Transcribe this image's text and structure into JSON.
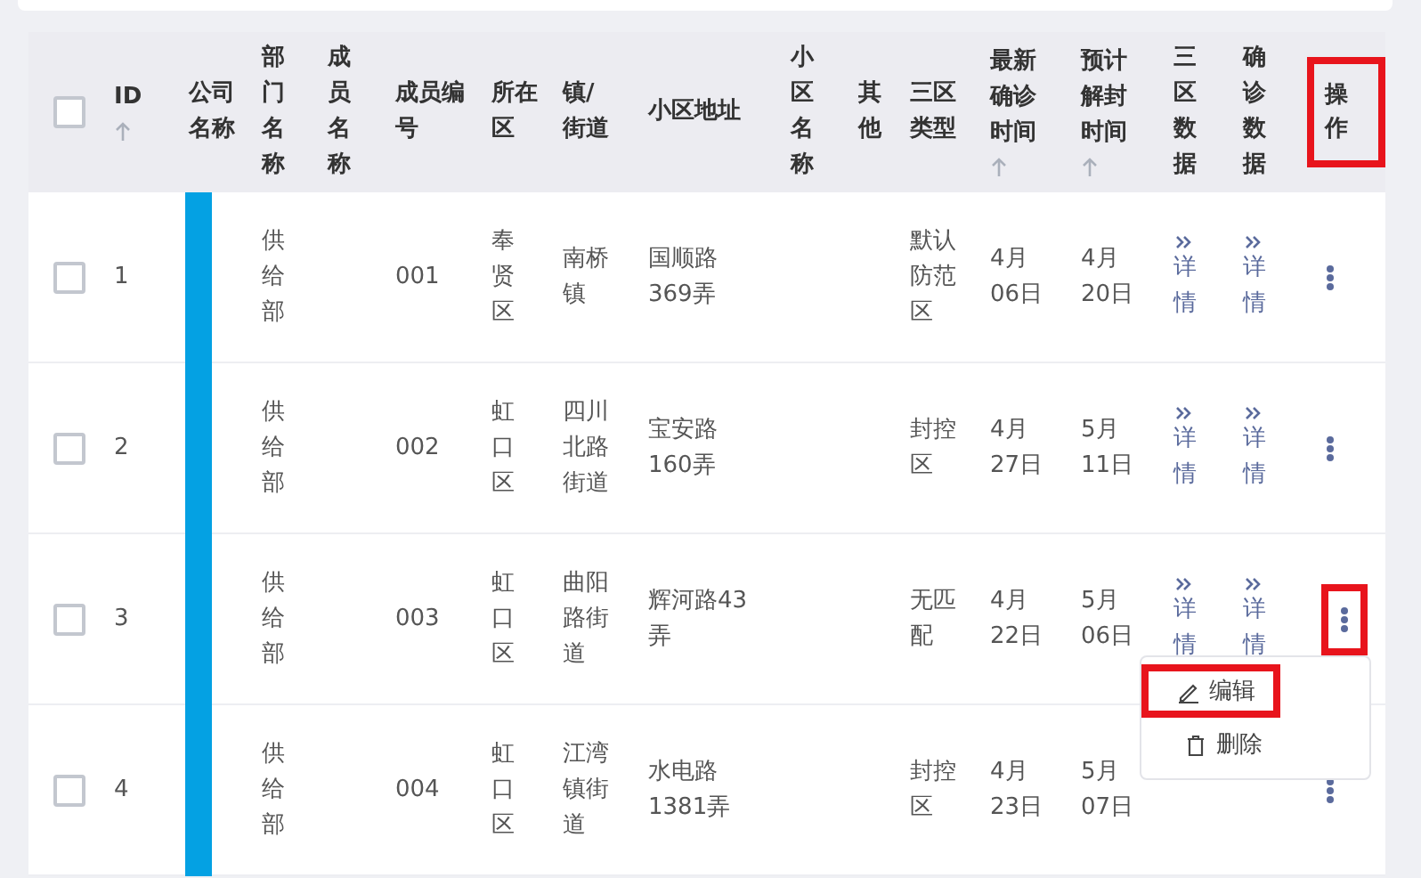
{
  "table": {
    "select_all": {
      "checked": false
    },
    "columns": [
      {
        "label": "ID",
        "sortable": true,
        "annotated": false
      },
      {
        "label": "公司名称",
        "sortable": false,
        "annotated": false
      },
      {
        "label": "部门名称",
        "sortable": false,
        "annotated": false
      },
      {
        "label": "成员名称",
        "sortable": false,
        "annotated": false
      },
      {
        "label": "成员编号",
        "sortable": false,
        "annotated": false
      },
      {
        "label": "所在区",
        "sortable": false,
        "annotated": false
      },
      {
        "label": "镇/街道",
        "sortable": false,
        "annotated": false
      },
      {
        "label": "小区地址",
        "sortable": false,
        "annotated": false
      },
      {
        "label": "小区名称",
        "sortable": false,
        "annotated": false
      },
      {
        "label": "其他",
        "sortable": false,
        "annotated": false
      },
      {
        "label": "三区类型",
        "sortable": false,
        "annotated": false
      },
      {
        "label": "最新确诊时间",
        "sortable": true,
        "annotated": false
      },
      {
        "label": "预计解封时间",
        "sortable": true,
        "annotated": false
      },
      {
        "label": "三区数据",
        "sortable": false,
        "annotated": false
      },
      {
        "label": "确诊数据",
        "sortable": false,
        "annotated": false
      },
      {
        "label": "操作",
        "sortable": false,
        "annotated": true
      }
    ],
    "rows": [
      {
        "checked": false,
        "id": "1",
        "color": "#04a1e3",
        "department": "供给部",
        "member_no": "001",
        "district": "奉贤区",
        "street": "南桥镇",
        "address": "国顺路369弄",
        "zone_type": "默认防范区",
        "latest_date": "4月06日",
        "unseal_date": "4月20日",
        "zone_data": "详情",
        "case_data": "详情",
        "menu_annotated": false,
        "menu_open": false
      },
      {
        "checked": false,
        "id": "2",
        "color": "#04a1e3",
        "department": "供给部",
        "member_no": "002",
        "district": "虹口区",
        "street": "四川北路街道",
        "address": "宝安路160弄",
        "zone_type": "封控区",
        "latest_date": "4月27日",
        "unseal_date": "5月11日",
        "zone_data": "详情",
        "case_data": "详情",
        "menu_annotated": false,
        "menu_open": false
      },
      {
        "checked": false,
        "id": "3",
        "color": "#04a1e3",
        "department": "供给部",
        "member_no": "003",
        "district": "虹口区",
        "street": "曲阳路街道",
        "address": "辉河路43弄",
        "zone_type": "无匹配",
        "latest_date": "4月22日",
        "unseal_date": "5月06日",
        "zone_data": "详情",
        "case_data": "详情",
        "menu_annotated": true,
        "menu_open": true
      },
      {
        "checked": false,
        "id": "4",
        "color": "#04a1e3",
        "department": "供给部",
        "member_no": "004",
        "district": "虹口区",
        "street": "江湾镇街道",
        "address": "水电路1381弄",
        "zone_type": "封控区",
        "latest_date": "4月23日",
        "unseal_date": "5月07日",
        "menu_annotated": false,
        "menu_open": false
      }
    ]
  },
  "row_menu": {
    "items": [
      {
        "kind": "edit",
        "label": "编辑",
        "annotated": true
      },
      {
        "kind": "delete",
        "label": "删除",
        "annotated": false
      }
    ]
  }
}
